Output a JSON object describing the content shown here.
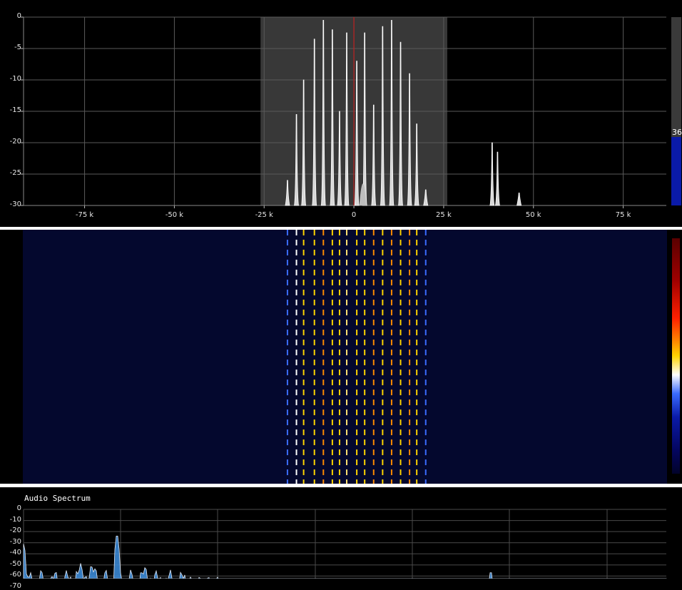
{
  "spectrum": {
    "y_ticks": [
      "0",
      "-5",
      "-10",
      "-15",
      "-20",
      "-25",
      "-30"
    ],
    "x_ticks": [
      "-75 k",
      "-50 k",
      "-25 k",
      "0",
      "25 k",
      "50 k",
      "75 k"
    ],
    "ylim": [
      -30,
      0
    ],
    "xlim": [
      -92,
      87
    ],
    "passband": [
      -26,
      26
    ],
    "center_marker": 0,
    "peaks": [
      {
        "f": -18.5,
        "db": -26
      },
      {
        "f": -16,
        "db": -15.5
      },
      {
        "f": -14,
        "db": -10
      },
      {
        "f": -11,
        "db": -3.5
      },
      {
        "f": -8.5,
        "db": -0.5
      },
      {
        "f": -6,
        "db": -2
      },
      {
        "f": -4,
        "db": -15
      },
      {
        "f": -2,
        "db": -2.5
      },
      {
        "f": 0.8,
        "db": -7
      },
      {
        "f": 3,
        "db": -2.5
      },
      {
        "f": 5.5,
        "db": -14
      },
      {
        "f": 8,
        "db": -1.5
      },
      {
        "f": 10.5,
        "db": -0.5
      },
      {
        "f": 13,
        "db": -4
      },
      {
        "f": 15.5,
        "db": -9
      },
      {
        "f": 17.5,
        "db": -17
      },
      {
        "f": 20,
        "db": -27.5
      },
      {
        "f": 38.5,
        "db": -20
      },
      {
        "f": 40,
        "db": -21.5
      },
      {
        "f": 46,
        "db": -28
      }
    ],
    "level_meter": {
      "value": "36",
      "fraction": 0.36,
      "colors": {
        "track": "#3a3a3a",
        "fill": "#0a1aa8"
      }
    }
  },
  "waterfall": {
    "background": "#04082e",
    "lines": [
      {
        "f": -18.5,
        "color": "#3a6bff"
      },
      {
        "f": -16,
        "color": "#ffffff"
      },
      {
        "f": -14,
        "color": "#ffd400"
      },
      {
        "f": -11,
        "color": "#ffd400"
      },
      {
        "f": -8.5,
        "color": "#ff8a00"
      },
      {
        "f": -6,
        "color": "#ffd400"
      },
      {
        "f": -4,
        "color": "#ffd400"
      },
      {
        "f": -2,
        "color": "#ffe070"
      },
      {
        "f": 0.8,
        "color": "#ffd400"
      },
      {
        "f": 3,
        "color": "#ffd400"
      },
      {
        "f": 5.5,
        "color": "#ff8a00"
      },
      {
        "f": 8,
        "color": "#ffd400"
      },
      {
        "f": 10.5,
        "color": "#ff8a00"
      },
      {
        "f": 13,
        "color": "#ffd400"
      },
      {
        "f": 15.5,
        "color": "#ff8a00"
      },
      {
        "f": 17.5,
        "color": "#ffd400"
      },
      {
        "f": 20,
        "color": "#3a6bff"
      }
    ]
  },
  "audio": {
    "title": "Audio Spectrum",
    "y_ticks": [
      "0",
      "-10",
      "-20",
      "-30",
      "-40",
      "-50",
      "-60",
      "-70"
    ],
    "ylim": [
      -70,
      0
    ],
    "accent": "#3d8fe0"
  }
}
